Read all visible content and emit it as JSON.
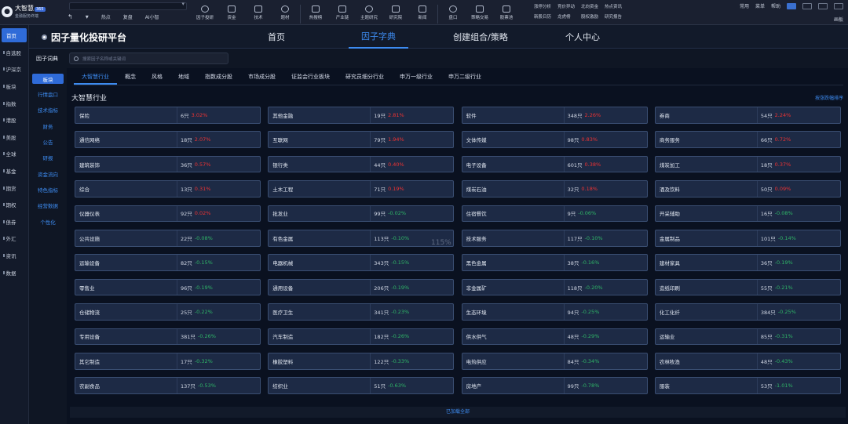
{
  "app": {
    "logo_text": "大智慧",
    "logo_sub": "金融服务终端",
    "logo_badge": "365"
  },
  "topnav": {
    "items": [
      "热点",
      "复盘",
      "AI小智"
    ]
  },
  "toolbar": {
    "items": [
      "因子投研",
      "资金",
      "技术",
      "题材",
      "热搜榜",
      "产业链",
      "主题研究",
      "研究院",
      "新闻",
      "盘口",
      "策略交易",
      "股票池"
    ]
  },
  "quicklinks": [
    "涨停分析",
    "竞价异动",
    "北向资金",
    "热点资讯",
    "新股日历",
    "龙虎榜",
    "股权激励",
    "研究报告"
  ],
  "window": {
    "menu": [
      "常用",
      "菜单",
      "帮助"
    ],
    "right_label": "画板"
  },
  "leftnav": {
    "items": [
      "首页",
      "自选股",
      "沪深京",
      "板块",
      "指数",
      "港股",
      "美股",
      "全球",
      "基金",
      "期货",
      "期权",
      "债券",
      "外汇",
      "资讯",
      "数据"
    ]
  },
  "header": {
    "brand": "因子量化投研平台",
    "tabs": [
      "首页",
      "因子字典",
      "创建组合/策略",
      "个人中心"
    ],
    "active_tab": 1
  },
  "dict": {
    "title": "因子词典",
    "search_placeholder": "搜索因子名称或关键词"
  },
  "categories": [
    "板块",
    "行情盘口",
    "技术指标",
    "财务",
    "公告",
    "研报",
    "资金流向",
    "特色指标",
    "经营数据",
    "个性化"
  ],
  "sector_tabs": [
    "大智慧行业",
    "概念",
    "风格",
    "地域",
    "指数成分股",
    "市场成分股",
    "证监会行业板块",
    "研究员细分行业",
    "申万一级行业",
    "申万二级行业"
  ],
  "section": {
    "title": "大智慧行业",
    "sort_link": "按涨跌幅排序",
    "zoom": "115%",
    "footer": "已加载全部"
  },
  "industries": [
    {
      "name": "保险",
      "count": "6只",
      "pct": "3.02%",
      "dir": "up"
    },
    {
      "name": "其他金融",
      "count": "19只",
      "pct": "2.81%",
      "dir": "up"
    },
    {
      "name": "软件",
      "count": "348只",
      "pct": "2.26%",
      "dir": "up"
    },
    {
      "name": "券商",
      "count": "54只",
      "pct": "2.24%",
      "dir": "up"
    },
    {
      "name": "通信网络",
      "count": "18只",
      "pct": "2.07%",
      "dir": "up"
    },
    {
      "name": "互联网",
      "count": "79只",
      "pct": "1.94%",
      "dir": "up"
    },
    {
      "name": "文体传媒",
      "count": "98只",
      "pct": "0.83%",
      "dir": "up"
    },
    {
      "name": "商务服务",
      "count": "66只",
      "pct": "0.72%",
      "dir": "up"
    },
    {
      "name": "建筑装饰",
      "count": "36只",
      "pct": "0.57%",
      "dir": "up"
    },
    {
      "name": "银行类",
      "count": "44只",
      "pct": "0.40%",
      "dir": "up"
    },
    {
      "name": "电子设备",
      "count": "601只",
      "pct": "0.38%",
      "dir": "up"
    },
    {
      "name": "煤炭加工",
      "count": "18只",
      "pct": "0.37%",
      "dir": "up"
    },
    {
      "name": "综合",
      "count": "13只",
      "pct": "0.31%",
      "dir": "up"
    },
    {
      "name": "土木工程",
      "count": "71只",
      "pct": "0.19%",
      "dir": "up"
    },
    {
      "name": "煤炭石油",
      "count": "32只",
      "pct": "0.18%",
      "dir": "up"
    },
    {
      "name": "酒及饮料",
      "count": "50只",
      "pct": "0.09%",
      "dir": "up"
    },
    {
      "name": "仪器仪表",
      "count": "92只",
      "pct": "0.02%",
      "dir": "up"
    },
    {
      "name": "批发业",
      "count": "99只",
      "pct": "-0.02%",
      "dir": "dn"
    },
    {
      "name": "住宿餐饮",
      "count": "9只",
      "pct": "-0.06%",
      "dir": "dn"
    },
    {
      "name": "开采辅助",
      "count": "16只",
      "pct": "-0.08%",
      "dir": "dn"
    },
    {
      "name": "公共设施",
      "count": "22只",
      "pct": "-0.08%",
      "dir": "dn"
    },
    {
      "name": "有色金属",
      "count": "113只",
      "pct": "-0.10%",
      "dir": "dn"
    },
    {
      "name": "技术服务",
      "count": "117只",
      "pct": "-0.10%",
      "dir": "dn"
    },
    {
      "name": "金属制品",
      "count": "101只",
      "pct": "-0.14%",
      "dir": "dn"
    },
    {
      "name": "运输设备",
      "count": "82只",
      "pct": "-0.15%",
      "dir": "dn"
    },
    {
      "name": "电器机械",
      "count": "343只",
      "pct": "-0.15%",
      "dir": "dn"
    },
    {
      "name": "黑色金属",
      "count": "38只",
      "pct": "-0.16%",
      "dir": "dn"
    },
    {
      "name": "建材家具",
      "count": "36只",
      "pct": "-0.19%",
      "dir": "dn"
    },
    {
      "name": "零售业",
      "count": "96只",
      "pct": "-0.19%",
      "dir": "dn"
    },
    {
      "name": "通用设备",
      "count": "206只",
      "pct": "-0.19%",
      "dir": "dn"
    },
    {
      "name": "非金属矿",
      "count": "118只",
      "pct": "-0.20%",
      "dir": "dn"
    },
    {
      "name": "造纸印刷",
      "count": "55只",
      "pct": "-0.21%",
      "dir": "dn"
    },
    {
      "name": "仓储物流",
      "count": "25只",
      "pct": "-0.22%",
      "dir": "dn"
    },
    {
      "name": "医疗卫生",
      "count": "341只",
      "pct": "-0.23%",
      "dir": "dn"
    },
    {
      "name": "生态环境",
      "count": "94只",
      "pct": "-0.25%",
      "dir": "dn"
    },
    {
      "name": "化工化纤",
      "count": "384只",
      "pct": "-0.25%",
      "dir": "dn"
    },
    {
      "name": "专用设备",
      "count": "381只",
      "pct": "-0.26%",
      "dir": "dn"
    },
    {
      "name": "汽车制造",
      "count": "182只",
      "pct": "-0.26%",
      "dir": "dn"
    },
    {
      "name": "供水供气",
      "count": "48只",
      "pct": "-0.29%",
      "dir": "dn"
    },
    {
      "name": "运输业",
      "count": "85只",
      "pct": "-0.31%",
      "dir": "dn"
    },
    {
      "name": "其它制造",
      "count": "17只",
      "pct": "-0.32%",
      "dir": "dn"
    },
    {
      "name": "橡胶塑料",
      "count": "122只",
      "pct": "-0.33%",
      "dir": "dn"
    },
    {
      "name": "电热供应",
      "count": "84只",
      "pct": "-0.34%",
      "dir": "dn"
    },
    {
      "name": "农林牧渔",
      "count": "48只",
      "pct": "-0.43%",
      "dir": "dn"
    },
    {
      "name": "农副食品",
      "count": "137只",
      "pct": "-0.53%",
      "dir": "dn"
    },
    {
      "name": "纺织业",
      "count": "51只",
      "pct": "-0.63%",
      "dir": "dn"
    },
    {
      "name": "房地产",
      "count": "99只",
      "pct": "-0.78%",
      "dir": "dn"
    },
    {
      "name": "服装",
      "count": "53只",
      "pct": "-1.01%",
      "dir": "dn"
    }
  ]
}
